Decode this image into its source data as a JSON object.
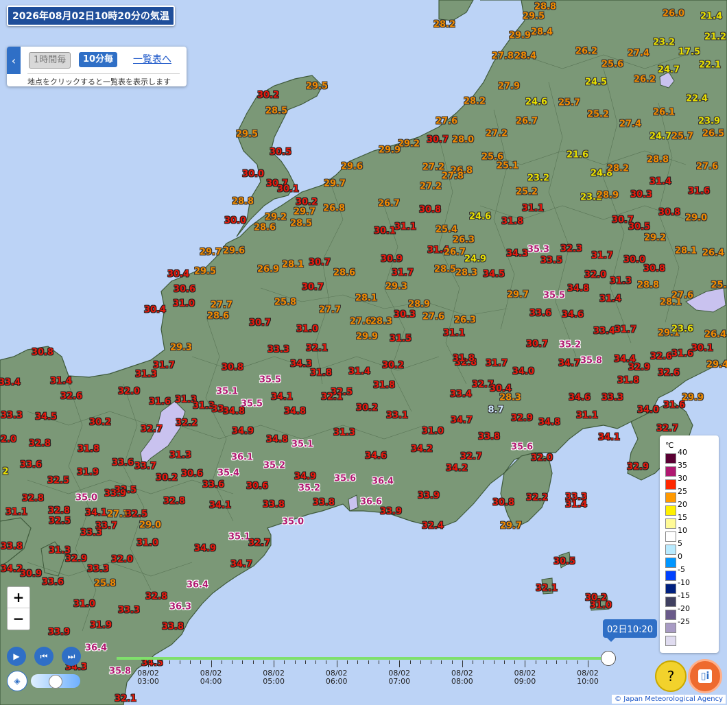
{
  "header": {
    "title": "2026年08月02日10時20分の気温"
  },
  "controls": {
    "hourly_label": "1時間毎",
    "tenmin_label": "10分毎",
    "list_link": "一覧表へ",
    "hint": "地点をクリックすると一覧表を表示します",
    "zoom_in": "+",
    "zoom_out": "−"
  },
  "legend": {
    "unit": "℃",
    "items": [
      {
        "label": "40",
        "color": "#5a0033"
      },
      {
        "label": "35",
        "color": "#b01870"
      },
      {
        "label": "30",
        "color": "#ff2800"
      },
      {
        "label": "25",
        "color": "#ff9900"
      },
      {
        "label": "20",
        "color": "#fff000"
      },
      {
        "label": "15",
        "color": "#fffa96"
      },
      {
        "label": "10",
        "color": "#ffffff"
      },
      {
        "label": "5",
        "color": "#b9ebff"
      },
      {
        "label": "0",
        "color": "#0096ff"
      },
      {
        "label": "-5",
        "color": "#0041ff"
      },
      {
        "label": "-10",
        "color": "#002080"
      },
      {
        "label": "-15",
        "color": "#404060"
      },
      {
        "label": "-20",
        "color": "#6a5a8a"
      },
      {
        "label": "-25",
        "color": "#a89bc4"
      },
      {
        "label": "",
        "color": "#e0dcf0"
      }
    ]
  },
  "timeline": {
    "current": "02日10:20",
    "ticks": [
      {
        "date": "08/02",
        "time": "03:00"
      },
      {
        "date": "08/02",
        "time": "04:00"
      },
      {
        "date": "08/02",
        "time": "05:00"
      },
      {
        "date": "08/02",
        "time": "06:00"
      },
      {
        "date": "08/02",
        "time": "07:00"
      },
      {
        "date": "08/02",
        "time": "08:00"
      },
      {
        "date": "08/02",
        "time": "09:00"
      },
      {
        "date": "08/02",
        "time": "10:00"
      }
    ]
  },
  "copyright": "© Japan Meteorological Agency",
  "temperatures": [
    [
      "28.8",
      795,
      10
    ],
    [
      "29.5",
      778,
      24
    ],
    [
      "26.0",
      982,
      20
    ],
    [
      "21.4",
      1037,
      24
    ],
    [
      "28.2",
      648,
      36
    ],
    [
      "29.9",
      758,
      52
    ],
    [
      "28.4",
      790,
      47
    ],
    [
      "23.2",
      968,
      62
    ],
    [
      "21.2",
      1043,
      54
    ],
    [
      "17.5",
      1005,
      76
    ],
    [
      "27.8",
      733,
      82
    ],
    [
      "28.4",
      766,
      82
    ],
    [
      "26.2",
      855,
      75
    ],
    [
      "27.4",
      931,
      78
    ],
    [
      "24.7",
      975,
      102
    ],
    [
      "22.1",
      1035,
      95
    ],
    [
      "25.6",
      893,
      94
    ],
    [
      "29.5",
      462,
      126
    ],
    [
      "30.2",
      391,
      139
    ],
    [
      "24.5",
      869,
      120
    ],
    [
      "26.2",
      940,
      116
    ],
    [
      "27.9",
      742,
      126
    ],
    [
      "28.5",
      403,
      162
    ],
    [
      "28.2",
      692,
      148
    ],
    [
      "24.6",
      782,
      149
    ],
    [
      "25.7",
      830,
      150
    ],
    [
      "22.4",
      1016,
      144
    ],
    [
      "27.6",
      651,
      177
    ],
    [
      "26.7",
      768,
      177
    ],
    [
      "25.2",
      872,
      167
    ],
    [
      "26.1",
      968,
      164
    ],
    [
      "23.9",
      1034,
      177
    ],
    [
      "27.4",
      919,
      181
    ],
    [
      "29.5",
      360,
      196
    ],
    [
      "30.5",
      409,
      222
    ],
    [
      "30.7",
      638,
      204
    ],
    [
      "28.0",
      675,
      204
    ],
    [
      "29.2",
      596,
      210
    ],
    [
      "29.9",
      568,
      219
    ],
    [
      "27.2",
      724,
      195
    ],
    [
      "24.7",
      963,
      199
    ],
    [
      "25.7",
      995,
      199
    ],
    [
      "26.5",
      1040,
      195
    ],
    [
      "25.6",
      718,
      229
    ],
    [
      "21.6",
      842,
      226
    ],
    [
      "25.1",
      740,
      242
    ],
    [
      "28.8",
      959,
      233
    ],
    [
      "29.6",
      513,
      243
    ],
    [
      "27.2",
      632,
      244
    ],
    [
      "26.8",
      673,
      249
    ],
    [
      "27.8",
      660,
      257
    ],
    [
      "27.6",
      1031,
      243
    ],
    [
      "30.0",
      369,
      254
    ],
    [
      "23.2",
      785,
      260
    ],
    [
      "24.8",
      877,
      253
    ],
    [
      "28.2",
      901,
      246
    ],
    [
      "30.7",
      404,
      268
    ],
    [
      "30.1",
      420,
      276
    ],
    [
      "29.7",
      488,
      268
    ],
    [
      "27.2",
      628,
      272
    ],
    [
      "31.4",
      963,
      265
    ],
    [
      "31.6",
      1019,
      279
    ],
    [
      "25.2",
      768,
      280
    ],
    [
      "23.2",
      862,
      288
    ],
    [
      "28.9",
      886,
      285
    ],
    [
      "30.3",
      935,
      284
    ],
    [
      "28.8",
      354,
      294
    ],
    [
      "30.2",
      447,
      295
    ],
    [
      "26.8",
      487,
      304
    ],
    [
      "26.7",
      567,
      297
    ],
    [
      "31.1",
      777,
      304
    ],
    [
      "29.7",
      444,
      309
    ],
    [
      "29.2",
      402,
      317
    ],
    [
      "30.8",
      627,
      306
    ],
    [
      "30.8",
      976,
      310
    ],
    [
      "29.0",
      1015,
      318
    ],
    [
      "30.0",
      343,
      322
    ],
    [
      "28.6",
      386,
      332
    ],
    [
      "28.5",
      439,
      326
    ],
    [
      "24.6",
      700,
      316
    ],
    [
      "31.8",
      747,
      323
    ],
    [
      "30.7",
      908,
      321
    ],
    [
      "30.5",
      932,
      331
    ],
    [
      "30.1",
      561,
      337
    ],
    [
      "31.1",
      591,
      331
    ],
    [
      "25.4",
      651,
      335
    ],
    [
      "26.3",
      676,
      350
    ],
    [
      "29.2",
      955,
      347
    ],
    [
      "29.7",
      307,
      368
    ],
    [
      "29.6",
      341,
      366
    ],
    [
      "35.3",
      785,
      364
    ],
    [
      "32.3",
      833,
      363
    ],
    [
      "31.4",
      639,
      365
    ],
    [
      "26.7",
      663,
      368
    ],
    [
      "24.9",
      693,
      378
    ],
    [
      "34.3",
      754,
      370
    ],
    [
      "33.5",
      804,
      380
    ],
    [
      "31.7",
      878,
      373
    ],
    [
      "30.0",
      925,
      379
    ],
    [
      "28.1",
      1000,
      366
    ],
    [
      "26.4",
      1040,
      369
    ],
    [
      "30.9",
      571,
      378
    ],
    [
      "26.9",
      391,
      393
    ],
    [
      "28.1",
      427,
      386
    ],
    [
      "30.7",
      466,
      383
    ],
    [
      "28.5",
      649,
      393
    ],
    [
      "28.3",
      680,
      398
    ],
    [
      "34.5",
      720,
      400
    ],
    [
      "30.8",
      954,
      392
    ],
    [
      "30.4",
      260,
      400
    ],
    [
      "29.5",
      299,
      396
    ],
    [
      "28.6",
      502,
      398
    ],
    [
      "31.7",
      587,
      398
    ],
    [
      "32.0",
      868,
      401
    ],
    [
      "31.3",
      905,
      410
    ],
    [
      "28.8",
      945,
      416
    ],
    [
      "25.",
      1048,
      416
    ],
    [
      "30.6",
      269,
      422
    ],
    [
      "30.7",
      456,
      419
    ],
    [
      "29.3",
      578,
      418
    ],
    [
      "34.8",
      843,
      421
    ],
    [
      "29.7",
      755,
      430
    ],
    [
      "35.5",
      808,
      431
    ],
    [
      "31.4",
      890,
      436
    ],
    [
      "27.6",
      995,
      431
    ],
    [
      "28.1",
      978,
      441
    ],
    [
      "31.0",
      268,
      443
    ],
    [
      "27.7",
      323,
      445
    ],
    [
      "25.8",
      416,
      441
    ],
    [
      "28.1",
      534,
      435
    ],
    [
      "28.9",
      611,
      444
    ],
    [
      "30.4",
      226,
      452
    ],
    [
      "28.6",
      318,
      461
    ],
    [
      "27.7",
      481,
      452
    ],
    [
      "30.3",
      590,
      459
    ],
    [
      "27.6",
      632,
      462
    ],
    [
      "26.3",
      678,
      467
    ],
    [
      "33.6",
      788,
      457
    ],
    [
      "34.6",
      835,
      459
    ],
    [
      "30.7",
      379,
      471
    ],
    [
      "27.6",
      526,
      469
    ],
    [
      "28.3",
      556,
      469
    ],
    [
      "31.0",
      448,
      480
    ],
    [
      "31.1",
      662,
      486
    ],
    [
      "33.4",
      881,
      483
    ],
    [
      "31.7",
      912,
      481
    ],
    [
      "29.1",
      975,
      486
    ],
    [
      "23.6",
      995,
      480
    ],
    [
      "26.4",
      1043,
      488
    ],
    [
      "29.9",
      535,
      491
    ],
    [
      "31.5",
      584,
      494
    ],
    [
      "29.3",
      264,
      507
    ],
    [
      "33.3",
      406,
      510
    ],
    [
      "32.1",
      462,
      508
    ],
    [
      "30.7",
      783,
      502
    ],
    [
      "35.2",
      831,
      503
    ],
    [
      "30.1",
      1024,
      508
    ],
    [
      "30.8",
      62,
      514
    ],
    [
      "34.3",
      439,
      531
    ],
    [
      "32.8",
      679,
      529
    ],
    [
      "31.7",
      724,
      530
    ],
    [
      "31.8",
      676,
      523
    ],
    [
      "34.7",
      830,
      530
    ],
    [
      "35.8",
      862,
      526
    ],
    [
      "34.4",
      911,
      524
    ],
    [
      "32.6",
      964,
      520
    ],
    [
      "31.6",
      995,
      516
    ],
    [
      "29.4",
      1046,
      532
    ],
    [
      "31.7",
      239,
      533
    ],
    [
      "30.8",
      339,
      536
    ],
    [
      "30.2",
      573,
      533
    ],
    [
      "31.3",
      213,
      546
    ],
    [
      "31.8",
      468,
      544
    ],
    [
      "31.4",
      524,
      542
    ],
    [
      "34.0",
      763,
      542
    ],
    [
      "32.9",
      932,
      536
    ],
    [
      "32.6",
      975,
      544
    ],
    [
      "33.4",
      14,
      558
    ],
    [
      "31.4",
      89,
      556
    ],
    [
      "35.5",
      394,
      554
    ],
    [
      "31.8",
      560,
      562
    ],
    [
      "31.8",
      916,
      555
    ],
    [
      "32.7",
      704,
      561
    ],
    [
      "30.4",
      730,
      567
    ],
    [
      "35.1",
      331,
      571
    ],
    [
      "32.0",
      188,
      571
    ],
    [
      "32.5",
      498,
      572
    ],
    [
      "32.1",
      484,
      579
    ],
    [
      "33.4",
      672,
      575
    ],
    [
      "34.1",
      411,
      579
    ],
    [
      "28.3",
      744,
      580
    ],
    [
      "34.6",
      845,
      580
    ],
    [
      "33.3",
      893,
      580
    ],
    [
      "32.6",
      104,
      578
    ],
    [
      "29.9",
      1010,
      580
    ],
    [
      "31.3",
      271,
      583
    ],
    [
      "31.6",
      233,
      586
    ],
    [
      "35.5",
      367,
      589
    ],
    [
      "31.3",
      297,
      592
    ],
    [
      "33.",
      320,
      597
    ],
    [
      "34.8",
      341,
      600
    ],
    [
      "30.2",
      535,
      595
    ],
    [
      "31.6",
      983,
      591
    ],
    [
      "8.7",
      723,
      598
    ],
    [
      "34.0",
      945,
      598
    ],
    [
      "32.7",
      973,
      625
    ],
    [
      "33.3",
      17,
      606
    ],
    [
      "34.5",
      67,
      608
    ],
    [
      "34.8",
      430,
      600
    ],
    [
      "33.1",
      579,
      606
    ],
    [
      "31.1",
      856,
      606
    ],
    [
      "30.2",
      146,
      616
    ],
    [
      "32.2",
      272,
      617
    ],
    [
      "32.7",
      221,
      626
    ],
    [
      "34.7",
      673,
      613
    ],
    [
      "32.9",
      761,
      610
    ],
    [
      "34.8",
      801,
      616
    ],
    [
      "34.9",
      354,
      629
    ],
    [
      "31.3",
      502,
      631
    ],
    [
      "31.0",
      631,
      629
    ],
    [
      "32.0",
      8,
      641
    ],
    [
      "32.8",
      58,
      647
    ],
    [
      "34.8",
      404,
      641
    ],
    [
      "35.1",
      441,
      648
    ],
    [
      "33.8",
      713,
      637
    ],
    [
      "34.1",
      888,
      638
    ],
    [
      "31.8",
      129,
      655
    ],
    [
      "34.2",
      615,
      655
    ],
    [
      "35.6",
      761,
      652
    ],
    [
      "36.1",
      353,
      667
    ],
    [
      "31.3",
      263,
      664
    ],
    [
      "34.6",
      548,
      665
    ],
    [
      "32.0",
      790,
      668
    ],
    [
      "32.7",
      687,
      666
    ],
    [
      "33.6",
      45,
      678
    ],
    [
      "33.6",
      179,
      675
    ],
    [
      "33.7",
      212,
      680
    ],
    [
      "35.2",
      400,
      679
    ],
    [
      "34.2",
      666,
      683
    ],
    [
      "32.9",
      930,
      681
    ],
    [
      "2",
      8,
      688
    ],
    [
      "35.4",
      333,
      690
    ],
    [
      "31.9",
      128,
      689
    ],
    [
      "30.6",
      280,
      691
    ],
    [
      "30.2",
      243,
      697
    ],
    [
      "34.9",
      445,
      695
    ],
    [
      "35.6",
      503,
      698
    ],
    [
      "36.4",
      558,
      702
    ],
    [
      "32.5",
      85,
      701
    ],
    [
      "33.6",
      311,
      707
    ],
    [
      "30.6",
      375,
      709
    ],
    [
      "35.2",
      451,
      712
    ],
    [
      "33.5",
      183,
      715
    ],
    [
      "35.0",
      126,
      726
    ],
    [
      "33.9",
      168,
      720
    ],
    [
      "32.8",
      48,
      727
    ],
    [
      "33.9",
      625,
      723
    ],
    [
      "32.2",
      783,
      726
    ],
    [
      "33.3",
      840,
      725
    ],
    [
      "32.8",
      254,
      731
    ],
    [
      "36.6",
      541,
      732
    ],
    [
      "30.8",
      734,
      733
    ],
    [
      "31.4",
      840,
      736
    ],
    [
      "33.8",
      399,
      736
    ],
    [
      "33.8",
      472,
      733
    ],
    [
      "34.1",
      321,
      737
    ],
    [
      "32.8",
      86,
      745
    ],
    [
      "34.1",
      140,
      748
    ],
    [
      "27.1",
      172,
      750
    ],
    [
      "32.5",
      199,
      750
    ],
    [
      "31.1",
      24,
      747
    ],
    [
      "33.9",
      570,
      746
    ],
    [
      "32.5",
      87,
      760
    ],
    [
      "35.0",
      427,
      761
    ],
    [
      "33.7",
      155,
      767
    ],
    [
      "29.0",
      219,
      766
    ],
    [
      "29.7",
      745,
      767
    ],
    [
      "32.4",
      631,
      767
    ],
    [
      "33.3",
      133,
      777
    ],
    [
      "35.1",
      349,
      783
    ],
    [
      "32.7",
      378,
      792
    ],
    [
      "31.0",
      215,
      792
    ],
    [
      "33.8",
      17,
      797
    ],
    [
      "31.3",
      87,
      803
    ],
    [
      "32.9",
      111,
      815
    ],
    [
      "34.9",
      299,
      800
    ],
    [
      "32.0",
      178,
      816
    ],
    [
      "34.7",
      352,
      823
    ],
    [
      "30.5",
      823,
      819
    ],
    [
      "34.2",
      17,
      830
    ],
    [
      "30.9",
      45,
      837
    ],
    [
      "33.3",
      143,
      830
    ],
    [
      "33.6",
      77,
      849
    ],
    [
      "25.8",
      153,
      851
    ],
    [
      "36.4",
      288,
      853
    ],
    [
      "32.1",
      797,
      858
    ],
    [
      "32.8",
      228,
      870
    ],
    [
      "30.2",
      869,
      872
    ],
    [
      "31.0",
      876,
      883
    ],
    [
      "31.0",
      123,
      881
    ],
    [
      "36.3",
      263,
      885
    ],
    [
      "33.3",
      188,
      890
    ],
    [
      "31.9",
      147,
      912
    ],
    [
      "33.8",
      252,
      914
    ],
    [
      "33.9",
      86,
      922
    ],
    [
      "36.4",
      140,
      945
    ],
    [
      "34.3",
      111,
      973
    ],
    [
      "34.5",
      222,
      967
    ],
    [
      "35.8",
      175,
      979
    ],
    [
      "32.1",
      183,
      1019
    ]
  ]
}
